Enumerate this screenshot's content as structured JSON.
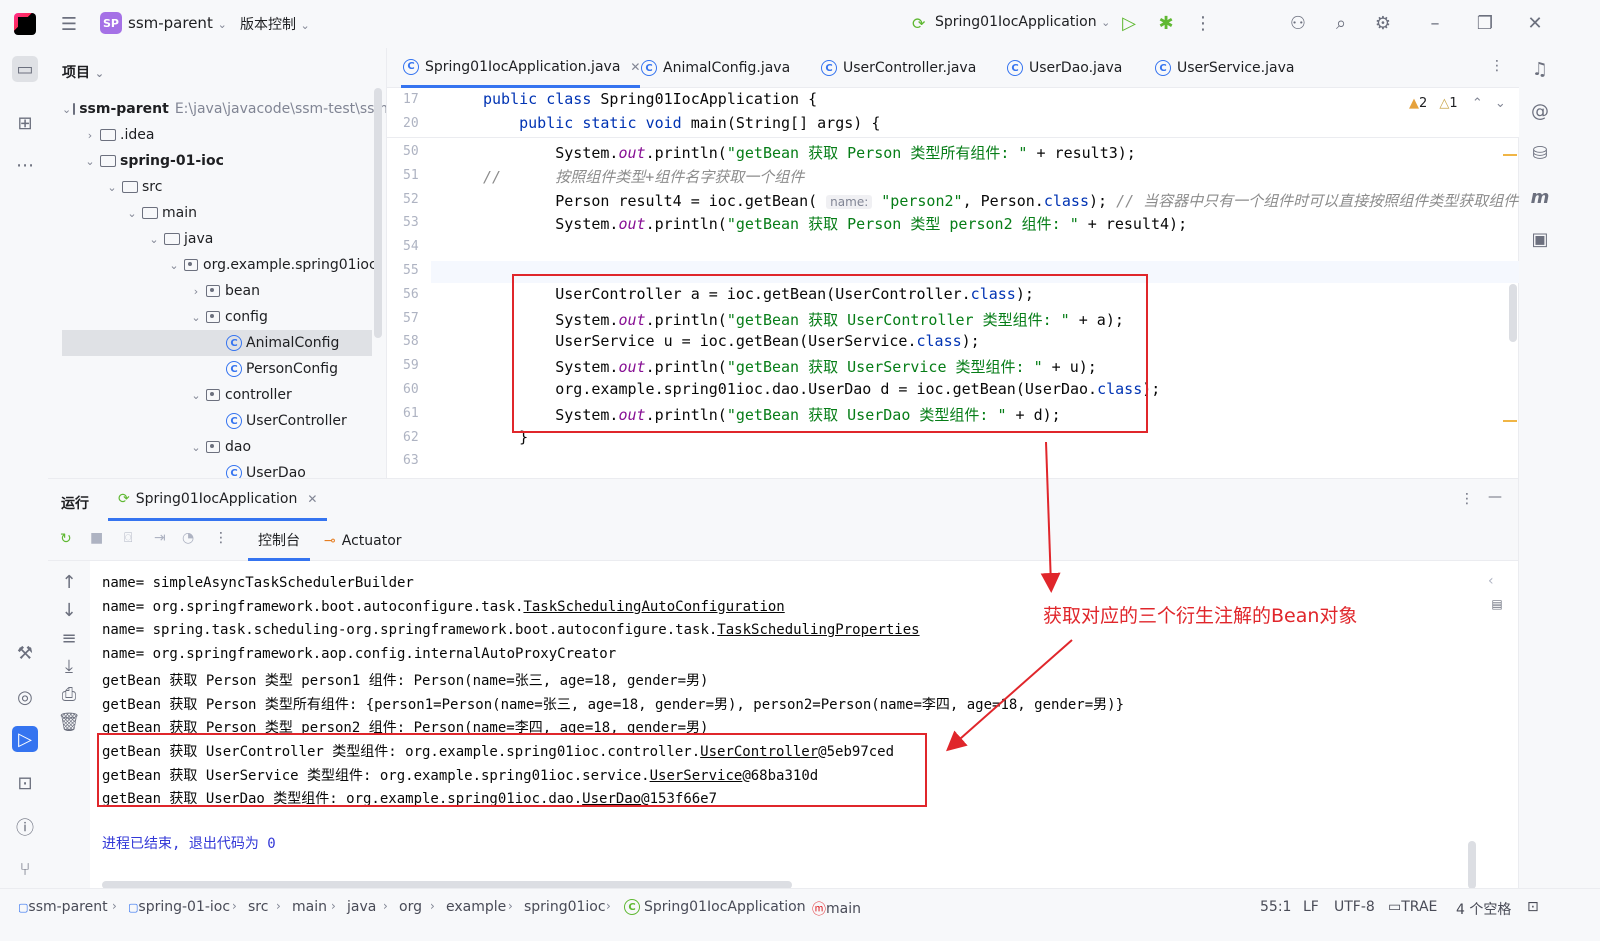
{
  "titlebar": {
    "project_badge": "SP",
    "project_name": "ssm-parent",
    "vcs_label": "版本控制",
    "run_config": "Spring01IocApplication"
  },
  "project_panel": {
    "header": "项目",
    "tree": [
      {
        "label": "ssm-parent",
        "path": "E:\\java\\javacode\\ssm-test\\ssm-p",
        "icon": "folder",
        "bold": true,
        "expanded": true
      },
      {
        "label": ".idea",
        "icon": "folder",
        "expanded": false
      },
      {
        "label": "spring-01-ioc",
        "icon": "folder",
        "bold": true,
        "expanded": true
      },
      {
        "label": "src",
        "icon": "folder",
        "expanded": true
      },
      {
        "label": "main",
        "icon": "folder",
        "expanded": true
      },
      {
        "label": "java",
        "icon": "folder",
        "expanded": true
      },
      {
        "label": "org.example.spring01ioc",
        "icon": "package",
        "expanded": true
      },
      {
        "label": "bean",
        "icon": "package",
        "expanded": false
      },
      {
        "label": "config",
        "icon": "package",
        "expanded": true
      },
      {
        "label": "AnimalConfig",
        "icon": "class",
        "selected": true
      },
      {
        "label": "PersonConfig",
        "icon": "class"
      },
      {
        "label": "controller",
        "icon": "package",
        "expanded": true
      },
      {
        "label": "UserController",
        "icon": "class"
      },
      {
        "label": "dao",
        "icon": "package",
        "expanded": true
      },
      {
        "label": "UserDao",
        "icon": "class"
      }
    ]
  },
  "editor": {
    "tabs": [
      {
        "label": "Spring01IocApplication.java",
        "active": true
      },
      {
        "label": "AnimalConfig.java"
      },
      {
        "label": "UserController.java"
      },
      {
        "label": "UserDao.java"
      },
      {
        "label": "UserService.java"
      }
    ],
    "warnings": {
      "warn_count": "2",
      "weak_count": "1"
    },
    "sticky_lines": [
      {
        "num": "17",
        "code": "public class Spring01IocApplication {"
      },
      {
        "num": "20",
        "code": "    public static void main(String[] args) {"
      }
    ],
    "lines": [
      {
        "num": "50",
        "code": "        System.out.println(\"getBean 获取 Person 类型所有组件: \" + result3);"
      },
      {
        "num": "51",
        "code": "//      按照组件类型+组件名字获取一个组件"
      },
      {
        "num": "52",
        "code": "        Person result4 = ioc.getBean( name: \"person2\", Person.class); // 当容器中只有一个组件时可以直接按照组件类型获取组件"
      },
      {
        "num": "53",
        "code": "        System.out.println(\"getBean 获取 Person 类型 person2 组件: \" + result4);"
      },
      {
        "num": "54",
        "code": ""
      },
      {
        "num": "55",
        "code": ""
      },
      {
        "num": "56",
        "code": "        UserController a = ioc.getBean(UserController.class);"
      },
      {
        "num": "57",
        "code": "        System.out.println(\"getBean 获取 UserController 类型组件: \" + a);"
      },
      {
        "num": "58",
        "code": "        UserService u = ioc.getBean(UserService.class);"
      },
      {
        "num": "59",
        "code": "        System.out.println(\"getBean 获取 UserService 类型组件: \" + u);"
      },
      {
        "num": "60",
        "code": "        org.example.spring01ioc.dao.UserDao d = ioc.getBean(UserDao.class);"
      },
      {
        "num": "61",
        "code": "        System.out.println(\"getBean 获取 UserDao 类型组件: \" + d);"
      },
      {
        "num": "62",
        "code": "    }"
      },
      {
        "num": "63",
        "code": ""
      }
    ]
  },
  "run_panel": {
    "title": "运行",
    "tab_label": "Spring01IocApplication",
    "console_tab": "控制台",
    "actuator_tab": "Actuator",
    "lines": [
      "name= simpleAsyncTaskSchedulerBuilder",
      "name= org.springframework.boot.autoconfigure.task.TaskSchedulingAutoConfiguration",
      "name= spring.task.scheduling-org.springframework.boot.autoconfigure.task.TaskSchedulingProperties",
      "name= org.springframework.aop.config.internalAutoProxyCreator",
      "getBean 获取 Person 类型 person1 组件: Person(name=张三, age=18, gender=男)",
      "getBean 获取 Person 类型所有组件: {person1=Person(name=张三, age=18, gender=男), person2=Person(name=李四, age=18, gender=男)}",
      "getBean 获取 Person 类型 person2 组件: Person(name=李四, age=18, gender=男)",
      "getBean 获取 UserController 类型组件: org.example.spring01ioc.controller.UserController@5eb97ced",
      "getBean 获取 UserService 类型组件: org.example.spring01ioc.service.UserService@68ba310d",
      "getBean 获取 UserDao 类型组件: org.example.spring01ioc.dao.UserDao@153f66e7"
    ],
    "exit_line": "进程已结束, 退出代码为 0"
  },
  "annotation": "获取对应的三个衍生注解的Bean对象",
  "statusbar": {
    "breadcrumbs": [
      "ssm-parent",
      "spring-01-ioc",
      "src",
      "main",
      "java",
      "org",
      "example",
      "spring01ioc",
      "Spring01IocApplication",
      "main"
    ],
    "position": "55:1",
    "line_sep": "LF",
    "encoding": "UTF-8",
    "plugin": "TRAE",
    "indent": "4 个空格"
  },
  "colors": {
    "accent": "#3574f0",
    "annotation_red": "#e0262b",
    "string_green": "#067d17",
    "keyword_blue": "#0033b3"
  }
}
